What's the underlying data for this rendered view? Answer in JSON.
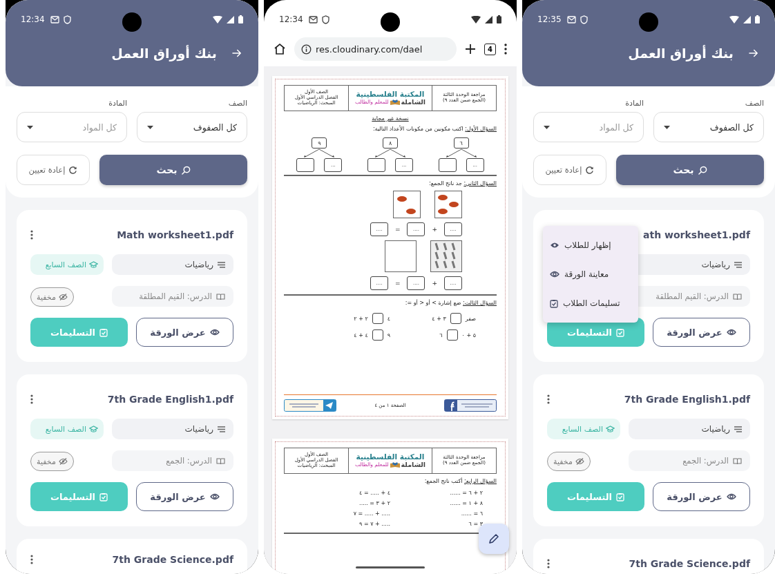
{
  "list_screen": {
    "kind": "app",
    "status_time": "12:34",
    "title": "بنك أوراق العمل",
    "filters": [
      {
        "label": "الصف",
        "value": "كل الصفوف"
      },
      {
        "label": "المادة",
        "placeholder": "كل المواد"
      }
    ],
    "search_button": "بحث",
    "reset_button": "إعادة تعيين",
    "cards": [
      {
        "title": "Math worksheet1.pdf",
        "subject": "رياضيات",
        "grade": "الصف السابع",
        "lesson": "الدرس: القيم المطلقة",
        "visibility": "مخفية",
        "view_button": "عرض الورقة",
        "submissions_button": "التسليمات"
      },
      {
        "title": "7th Grade English1.pdf",
        "subject": "رياضيات",
        "grade": "الصف السابع",
        "lesson": "الدرس: الجمع",
        "visibility": "مخفية",
        "view_button": "عرض الورقة",
        "submissions_button": "التسليمات"
      },
      {
        "title": "7th Grade Science.pdf"
      }
    ]
  },
  "browser_screen": {
    "kind": "browser",
    "status_time": "12:34",
    "url": "res.cloudinary.com/dael",
    "tab_count": "4",
    "pages": [
      {
        "header": {
          "unit_lines": [
            "مراجعة الوحدة الثالثة",
            "(الجمع ضمن العدد ٩)"
          ],
          "logo_title": "المكتبة الفلسطينية",
          "logo_subtitle": "الشاملة",
          "logo_tagline": "للمعلم والطالب",
          "info_lines": [
            "الصف الأول",
            "الفصل الدراسي الأول",
            "المبحث: الرياضيات"
          ]
        },
        "sections": [
          {
            "kind": "note",
            "text": "نسخة غير مجابة"
          },
          {
            "kind": "trees",
            "label": "السؤال الأول:",
            "text": "اكتب مكونين من مكونات الأعداد التالية:",
            "numbers": [
              "٦",
              "٨",
              "٩"
            ],
            "blank": "..."
          },
          {
            "kind": "pictures",
            "label": "السؤال الثاني:",
            "text": "جد ناتج الجمع:",
            "rows": [
              {
                "kind": "cars",
                "blanks": [
                  "....",
                  "....",
                  "...."
                ],
                "plus": "+",
                "equals": "="
              },
              {
                "kind": "feathers",
                "blanks": [
                  "....",
                  "....",
                  "...."
                ],
                "plus": "+",
                "equals": "="
              }
            ]
          },
          {
            "kind": "compare",
            "label": "السؤال الثالث:",
            "text": "ضع إشارة > أو < أو =:",
            "pairs": [
              {
                "before": "صفر",
                "after": "٣ + ٤"
              },
              {
                "before": "٤",
                "after": "٢ + ٢"
              },
              {
                "before": "٥ + ٠",
                "after": "٦"
              },
              {
                "before": "٩",
                "after": "٤ + ٤"
              }
            ]
          },
          {
            "kind": "footer",
            "page_label": "الصفحة ١ من ٤"
          }
        ]
      },
      {
        "header": {
          "unit_lines": [
            "مراجعة الوحدة الثالثة",
            "(الجمع ضمن العدد ٩)"
          ],
          "logo_title": "المكتبة الفلسطينية",
          "logo_subtitle": "الشاملة",
          "logo_tagline": "للمعلم والطالب",
          "info_lines": [
            "الصف الأول",
            "الفصل الدراسي الأول",
            "المبحث: الرياضيات"
          ]
        },
        "sections": [
          {
            "kind": "equations",
            "label": "السؤال الرابع:",
            "text": "أكتب ناتج الجمع:",
            "rows": [
              [
                "٢ + ٦ = ......",
                "٤ + ..... = ٤"
              ],
              [
                "٨ + ١ = ......",
                "٢ + ٣ = ....."
              ],
              [
                "٦ = ......",
                "..... + ..... = ٧"
              ],
              [
                "٣ = ٦",
                "..... + ٧ = ٩"
              ]
            ]
          }
        ]
      }
    ]
  },
  "menu_screen": {
    "kind": "app",
    "status_time": "12:35",
    "title": "بنك أوراق العمل",
    "filters": [
      {
        "label": "الصف",
        "value": "كل الصفوف"
      },
      {
        "label": "المادة",
        "placeholder": "كل المواد"
      }
    ],
    "search_button": "بحث",
    "reset_button": "إعادة تعيين",
    "cards": [
      {
        "title": "ath worksheet1.pdf",
        "subject": "رياضيات",
        "lesson": "الدرس: القيم المطلقة",
        "view_button": "عرض الورقة",
        "submissions_button": "التسليمات"
      },
      {
        "title": "7th Grade English1.pdf",
        "subject": "رياضيات",
        "grade": "الصف السابع",
        "lesson": "الدرس: الجمع",
        "visibility": "مخفية",
        "view_button": "عرض الورقة",
        "submissions_button": "التسليمات"
      },
      {
        "title": "7th Grade Science.pdf"
      }
    ],
    "menu": [
      {
        "kind": "show",
        "label": "إظهار للطلاب"
      },
      {
        "kind": "preview",
        "label": "معاينة الورقة"
      },
      {
        "kind": "submissions",
        "label": "تسليمات الطلاب"
      }
    ]
  }
}
